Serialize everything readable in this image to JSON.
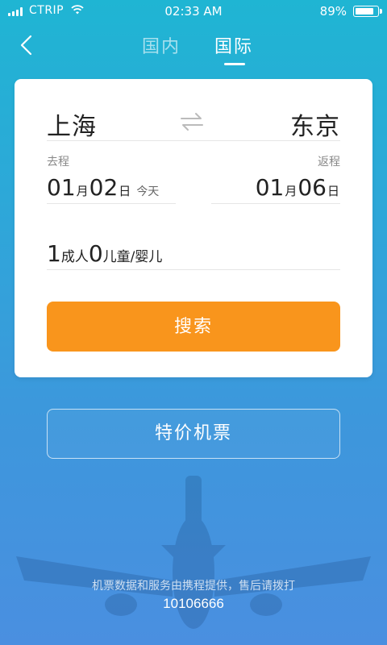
{
  "status_bar": {
    "carrier": "CTRIP",
    "time": "02:33 AM",
    "battery_percent": "89%"
  },
  "header": {
    "back_icon": "chevron-left-icon",
    "tabs": [
      {
        "label": "国内",
        "active": false
      },
      {
        "label": "国际",
        "active": true
      }
    ]
  },
  "search_card": {
    "from_city": "上海",
    "to_city": "东京",
    "swap_icon": "swap-arrows-icon",
    "depart": {
      "label": "去程",
      "month": "01",
      "month_unit": "月",
      "day": "02",
      "day_unit": "日",
      "hint": "今天"
    },
    "return": {
      "label": "返程",
      "month": "01",
      "month_unit": "月",
      "day": "06",
      "day_unit": "日"
    },
    "passengers": {
      "adult_count": "1",
      "adult_label": "成人",
      "child_count": "0",
      "child_label": "儿童/婴儿"
    },
    "search_label": "搜索"
  },
  "deals_label": "特价机票",
  "footer": {
    "note": "机票数据和服务由携程提供，售后请拨打",
    "phone": "10106666"
  },
  "colors": {
    "accent": "#f9951c",
    "background_top": "#1fb5d3",
    "background_bottom": "#4a8fe0"
  }
}
